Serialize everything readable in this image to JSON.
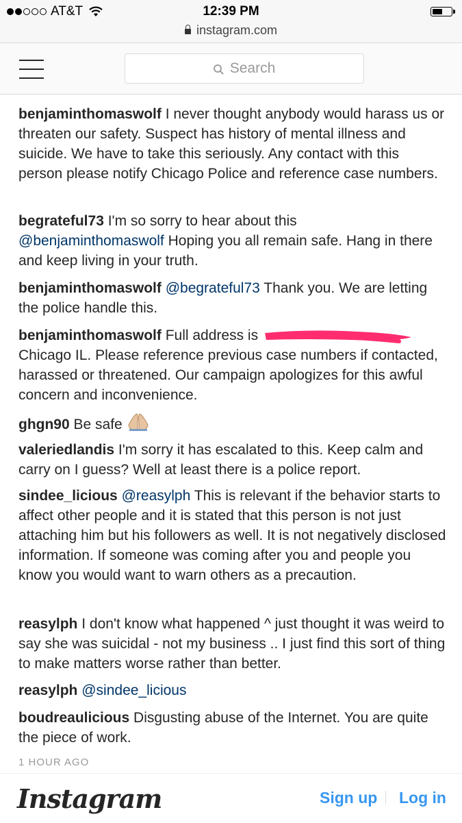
{
  "status_bar": {
    "carrier": "AT&T",
    "time": "12:39 PM",
    "url": "instagram.com",
    "battery_level": 0.6
  },
  "nav": {
    "search_placeholder": "Search",
    "menu_icon": "hamburger-icon",
    "search_icon": "search-icon"
  },
  "comments": [
    {
      "user": "benjaminthomaswolf",
      "text": "I never thought anybody would harass us or threaten our safety. Suspect has history of mental illness and suicide. We have to take this seriously. Any contact with this person please notify Chicago Police and reference case numbers."
    },
    {
      "user": "begrateful73",
      "pre": "I'm so sorry to hear about this",
      "mention": "@benjaminthomaswolf",
      "text": "Hoping you all remain safe. Hang in there and keep living in your truth."
    },
    {
      "user": "benjaminthomaswolf",
      "mention": "@begrateful73",
      "text": "Thank you. We are letting the police handle this."
    },
    {
      "user": "benjaminthomaswolf",
      "pre": "Full address is",
      "text": "Chicago IL. Please reference previous case numbers if contacted, harassed or threatened. Our campaign apologizes for this awful concern and inconvenience."
    },
    {
      "user": "ghgn90",
      "text": "Be safe"
    },
    {
      "user": "valeriedlandis",
      "text": "I'm sorry it has escalated to this. Keep calm and carry on I guess? Well at least there is a police report."
    },
    {
      "user": "sindee_licious",
      "mention": "@reasylph",
      "text": "This is relevant if the behavior starts to affect other people and it is stated that this person is not just attaching him but his followers as well. It is not negatively disclosed information. If someone was coming after you and people you know you would want to warn others as a precaution."
    },
    {
      "user": "reasylph",
      "text": "I don't know what happened ^ just thought it was weird to say she was suicidal - not my business .. I just find this sort of thing to make matters worse rather than better."
    },
    {
      "user": "reasylph",
      "mention": "@sindee_licious"
    },
    {
      "user": "boudreaulicious",
      "text": "Disgusting abuse of the Internet. You are quite the piece of work."
    }
  ],
  "timestamp": "1 HOUR AGO",
  "footer": {
    "logo": "Instagram",
    "signup": "Sign up",
    "login": "Log in"
  },
  "colors": {
    "link": "#3897f0",
    "mention": "#003569",
    "redaction": "#ff2d6f"
  }
}
